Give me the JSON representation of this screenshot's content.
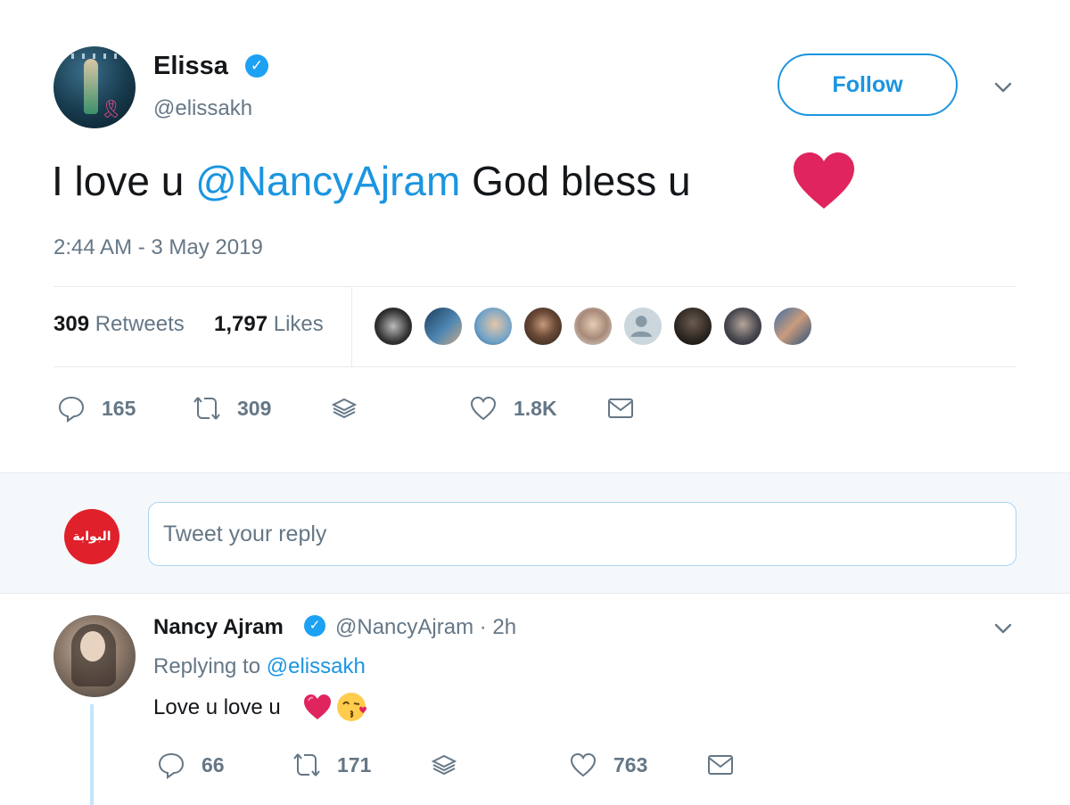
{
  "main_tweet": {
    "author_name": "Elissa",
    "author_handle": "@elissakh",
    "verified": true,
    "follow_label": "Follow",
    "text_before": "I love u ",
    "mention": "@NancyAjram",
    "text_after": " God bless u",
    "emoji": "heart-emoji",
    "timestamp": "2:44 AM - 3 May 2019",
    "retweets_count": "309",
    "retweets_label": " Retweets",
    "likes_count": "1,797",
    "likes_label": " Likes",
    "liker_avatars": 9,
    "actions": {
      "reply_count": "165",
      "retweet_count": "309",
      "like_count": "1.8K"
    }
  },
  "composer": {
    "avatar_text": "البوابة",
    "placeholder": "Tweet your reply"
  },
  "reply_tweet": {
    "author_name": "Nancy Ajram",
    "verified": true,
    "handle_time": "@NancyAjram · 2h",
    "replying_to_prefix": "Replying to ",
    "replying_to_handle": "@elissakh",
    "text": "Love u love u",
    "emojis": [
      "heart-emoji",
      "kiss-face-emoji"
    ],
    "actions": {
      "reply_count": "66",
      "retweet_count": "171",
      "like_count": "763"
    }
  },
  "colors": {
    "accent": "#1b95e0",
    "verified": "#1da1f2",
    "secondary_text": "#657786",
    "heart_red": "#e0245e",
    "brand_red": "#e0202a"
  }
}
